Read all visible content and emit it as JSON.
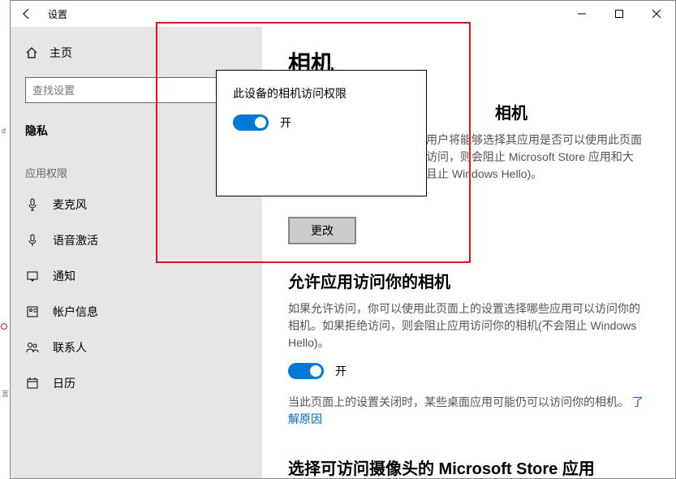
{
  "window": {
    "title": "设置"
  },
  "sidebar": {
    "home": "主页",
    "search_placeholder": "查找设置",
    "group": "隐私",
    "subhead": "应用权限",
    "items": [
      {
        "label": "麦克风"
      },
      {
        "label": "语音激活"
      },
      {
        "label": "通知"
      },
      {
        "label": "帐户信息"
      },
      {
        "label": "联系人"
      },
      {
        "label": "日历"
      }
    ]
  },
  "content": {
    "page_title": "相机",
    "sec1": {
      "heading_tail": "相机",
      "body_tail1": "用户将能够选择其应用是否可以使用此页面",
      "body_tail2": "访问，则会阻止 Microsoft Store 应用和大",
      "body_tail3": "且止 Windows Hello)。",
      "change_btn": "更改"
    },
    "sec2": {
      "heading": "允许应用访问你的相机",
      "body": "如果允许访问，你可以使用此页面上的设置选择哪些应用可以访问你的相机。如果拒绝访问，则会阻止应用访问你的相机(不会阻止 Windows Hello)。",
      "toggle_label": "开",
      "footer_pre": "当此页面上的设置关闭时，某些桌面应用可能仍可以访问你的相机。",
      "footer_link": "了解原因"
    },
    "sec3": {
      "heading": "选择可访问摄像头的 Microsoft Store 应用"
    }
  },
  "modal": {
    "title": "此设备的相机访问权限",
    "toggle_label": "开"
  }
}
